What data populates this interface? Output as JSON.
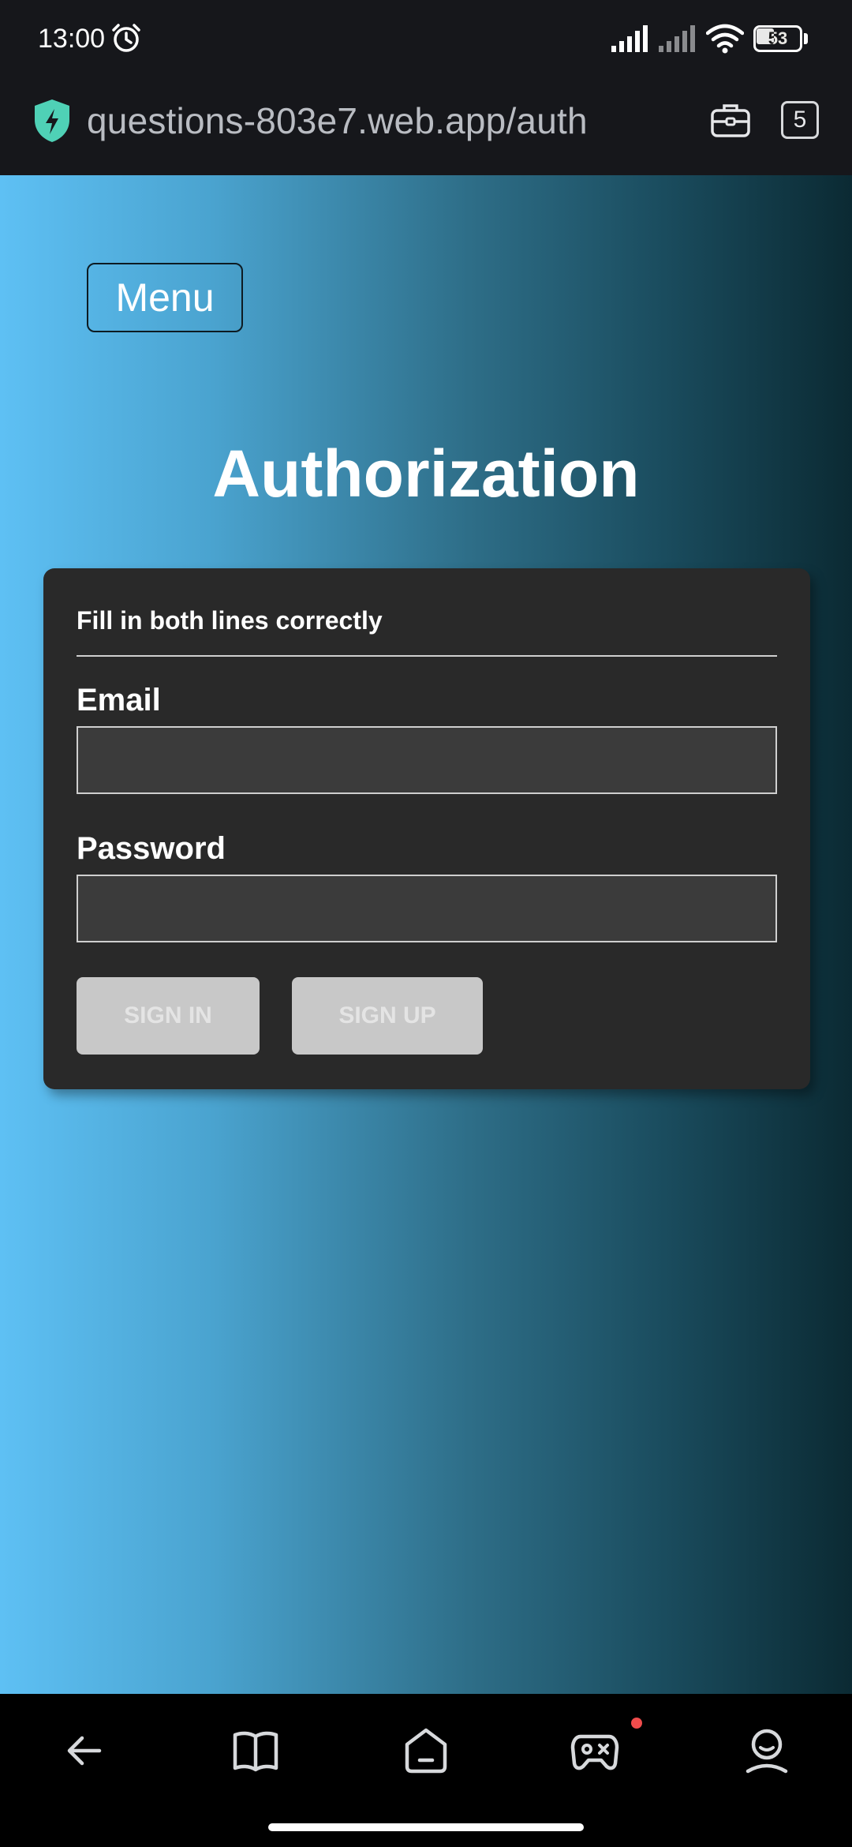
{
  "status_bar": {
    "time": "13:00",
    "battery_level": "53"
  },
  "address_bar": {
    "url": "questions-803e7.web.app/auth",
    "tab_count": "5"
  },
  "page": {
    "menu_label": "Menu",
    "title": "Authorization"
  },
  "auth_form": {
    "subtitle": "Fill in both lines correctly",
    "email_label": "Email",
    "email_value": "",
    "password_label": "Password",
    "password_value": "",
    "sign_in_label": "SIGN IN",
    "sign_up_label": "SIGN UP"
  },
  "colors": {
    "gradient_start": "#5ec0f4",
    "gradient_end": "#0b2a33",
    "card_bg": "#292929",
    "button_bg": "#c8c8c8",
    "notification_dot": "#ef4c4c",
    "shield_accent": "#4fd1b6"
  },
  "icons": {
    "status": [
      "alarm-icon",
      "signal-icon",
      "wifi-icon",
      "battery-icon"
    ],
    "address_bar": [
      "shield-icon",
      "toolbox-icon"
    ],
    "bottom_nav": [
      "back-arrow-icon",
      "book-icon",
      "home-icon",
      "gamepad-icon",
      "profile-icon"
    ]
  }
}
